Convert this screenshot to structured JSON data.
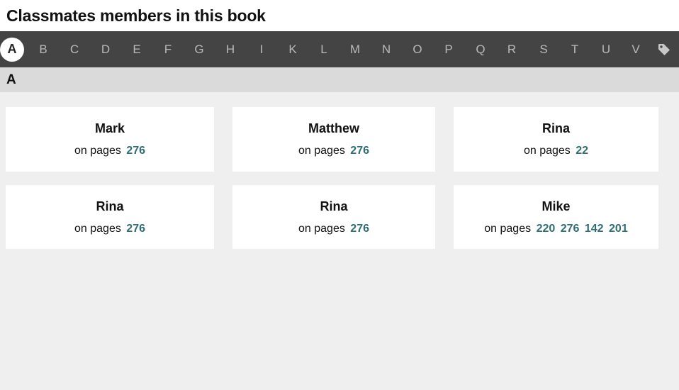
{
  "header": {
    "title": "Classmates members in this book"
  },
  "alphabet": {
    "letters": [
      "A",
      "B",
      "C",
      "D",
      "E",
      "F",
      "G",
      "H",
      "I",
      "K",
      "L",
      "M",
      "N",
      "O",
      "P",
      "Q",
      "R",
      "S",
      "T",
      "U",
      "V"
    ],
    "active": "A",
    "tag_icon": "tag-icon"
  },
  "section": {
    "letter": "A"
  },
  "pages_prefix": "on pages",
  "colors": {
    "accent": "#2f6e73",
    "bar": "#444444",
    "section": "#dadada",
    "background": "#efefef"
  },
  "members": [
    {
      "name": "Mark",
      "pages": [
        "276"
      ]
    },
    {
      "name": "Matthew",
      "pages": [
        "276"
      ]
    },
    {
      "name": "Rina",
      "pages": [
        "22"
      ]
    },
    {
      "name": "Rina",
      "pages": [
        "276"
      ]
    },
    {
      "name": "Rina",
      "pages": [
        "276"
      ]
    },
    {
      "name": "Mike",
      "pages": [
        "220",
        "276",
        "142",
        "201"
      ]
    }
  ]
}
